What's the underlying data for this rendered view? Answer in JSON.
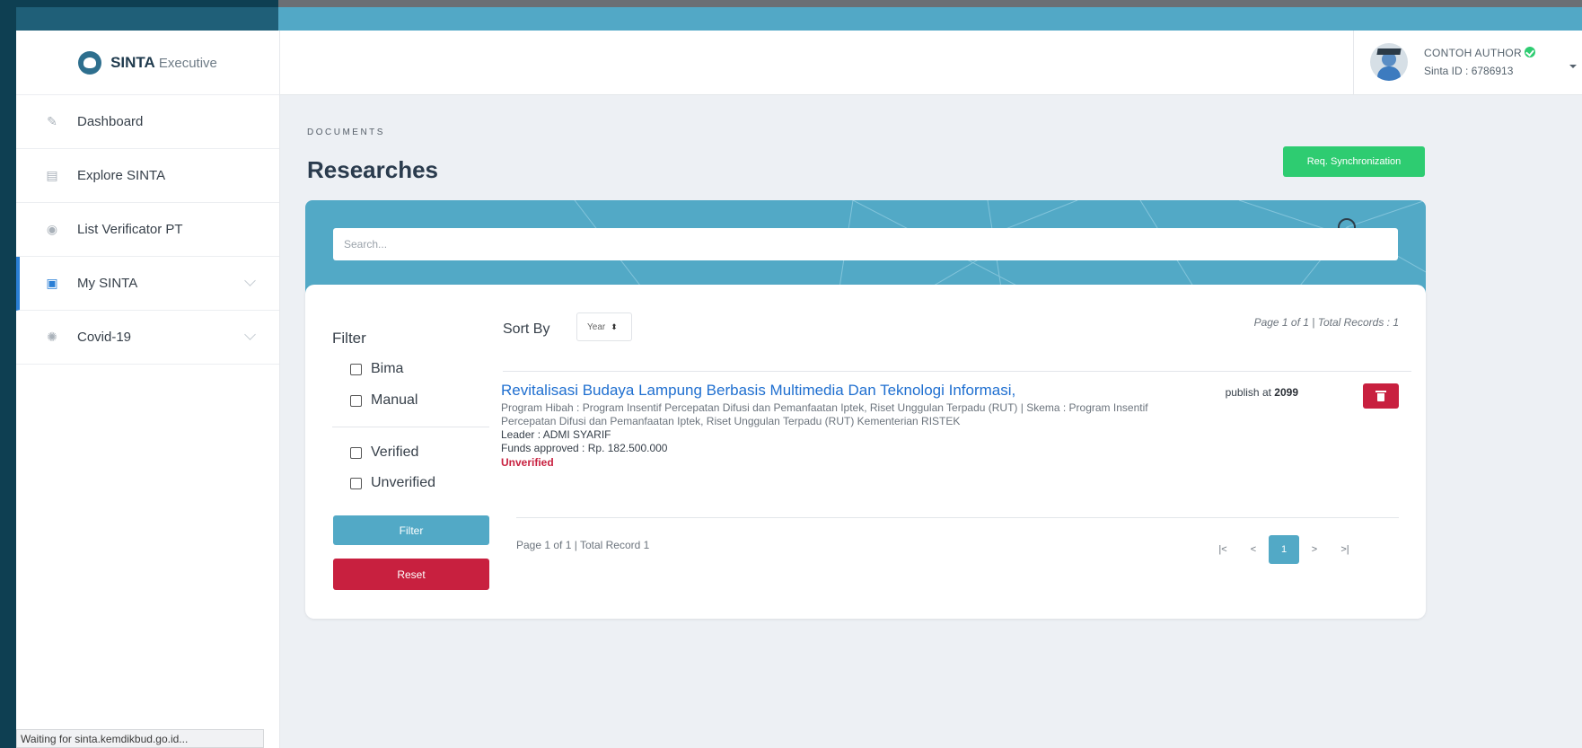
{
  "brand": {
    "name": "SINTA",
    "sub": "Executive"
  },
  "sidebar": {
    "items": [
      {
        "label": "Dashboard"
      },
      {
        "label": "Explore SINTA"
      },
      {
        "label": "List Verificator PT"
      },
      {
        "label": "My SINTA"
      },
      {
        "label": "Covid-19"
      }
    ],
    "active_item": "My SINTA"
  },
  "status_bar": {
    "text": "Waiting for sinta.kemdikbud.go.id..."
  },
  "user": {
    "name": "CONTOH AUTHOR",
    "sinta_id": "Sinta ID : 6786913"
  },
  "page": {
    "breadcrumb": "DOCUMENTS",
    "title": "Researches",
    "sync_button": "Req. Synchronization"
  },
  "search": {
    "placeholder": "Search..."
  },
  "filter": {
    "title": "Filter",
    "options": [
      "Bima",
      "Manual",
      "Verified",
      "Unverified"
    ],
    "filter_button": "Filter",
    "reset_button": "Reset"
  },
  "sort": {
    "label": "Sort By",
    "selected": "Year"
  },
  "pagination": {
    "top_info": "Page 1 of 1 | Total Records : 1",
    "bottom_info": "Page 1 of 1 | Total Record 1",
    "first": "|<",
    "prev": "<",
    "current": "1",
    "next": ">",
    "last": ">|"
  },
  "results": [
    {
      "title": "Revitalisasi Budaya Lampung Berbasis Multimedia Dan Teknologi Informasi,",
      "meta": "Program Hibah : Program Insentif Percepatan Difusi dan Pemanfaatan Iptek, Riset Unggulan Terpadu (RUT)  |  Skema : Program Insentif Percepatan Difusi dan Pemanfaatan Iptek, Riset Unggulan Terpadu (RUT) Kementerian RISTEK",
      "leader": "Leader : ADMI SYARIF",
      "funds": "Funds approved : Rp. 182.500.000",
      "status": "Unverified",
      "publish_label": "publish at",
      "publish_year": "2099"
    }
  ],
  "colors": {
    "accent": "#52a9c6",
    "success": "#2ecc71",
    "danger": "#c8203f",
    "link": "#1f6fd0"
  }
}
